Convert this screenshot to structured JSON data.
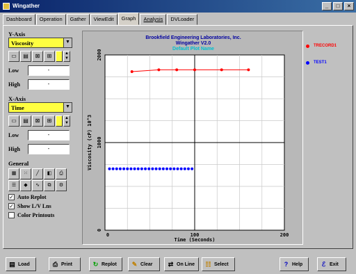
{
  "window": {
    "title": "Wingather"
  },
  "tabs": [
    {
      "label": "Dashboard"
    },
    {
      "label": "Operation"
    },
    {
      "label": "Gather"
    },
    {
      "label": "ViewEdit"
    },
    {
      "label": "Graph"
    },
    {
      "label": "Analysis"
    },
    {
      "label": "DVLoader"
    }
  ],
  "active_tab": "Graph",
  "y_axis": {
    "title": "Y-Axis",
    "selected": "Viscosity",
    "low_label": "Low",
    "low_value": "-",
    "high_label": "High",
    "high_value": "-"
  },
  "x_axis": {
    "title": "X-Axis",
    "selected": "Time",
    "low_label": "Low",
    "low_value": "-",
    "high_label": "High",
    "high_value": "-"
  },
  "general": {
    "title": "General",
    "checkboxes": [
      {
        "label": "Auto Replot",
        "checked": true
      },
      {
        "label": "Show L/V Lns",
        "checked": true
      },
      {
        "label": "Color Printouts",
        "checked": false
      }
    ]
  },
  "plot_header": {
    "line1": "Brookfield Engineering Laboratories, Inc.",
    "line2": "Wingather V2.0",
    "line3": "Default Plot Name"
  },
  "legend": [
    {
      "name": "TRECORD1",
      "color": "#ff0000"
    },
    {
      "name": "TEST1",
      "color": "#0000ff"
    }
  ],
  "toolbar": {
    "load": "Load",
    "print": "Print",
    "replot": "Replot",
    "clear": "Clear",
    "online": "On Line",
    "select": "Select",
    "help": "Help",
    "exit": "Exit"
  },
  "chart_data": {
    "type": "scatter",
    "xlabel": "Time (Seconds)",
    "ylabel": "Viscosity (cP) 10^3",
    "xlim": [
      0,
      200
    ],
    "ylim": [
      0,
      2000
    ],
    "x_ticks": [
      "0",
      "100",
      "200"
    ],
    "y_ticks": [
      "2000",
      "1000",
      "0"
    ],
    "grid": true,
    "series": [
      {
        "name": "TRECORD1",
        "color": "#ff0000",
        "line": true,
        "x": [
          30,
          60,
          80,
          100,
          130,
          160
        ],
        "y": [
          1810,
          1830,
          1830,
          1830,
          1830,
          1830
        ]
      },
      {
        "name": "TEST1",
        "color": "#0000ff",
        "line": false,
        "x": [
          5,
          9,
          13,
          17,
          21,
          25,
          29,
          33,
          37,
          41,
          45,
          49,
          53,
          57,
          61,
          65,
          69,
          73,
          77,
          81,
          85,
          89,
          93,
          97
        ],
        "y": [
          700,
          700,
          700,
          700,
          700,
          700,
          700,
          700,
          700,
          700,
          700,
          700,
          700,
          700,
          700,
          700,
          700,
          700,
          700,
          700,
          700,
          700,
          700,
          700
        ]
      }
    ]
  }
}
